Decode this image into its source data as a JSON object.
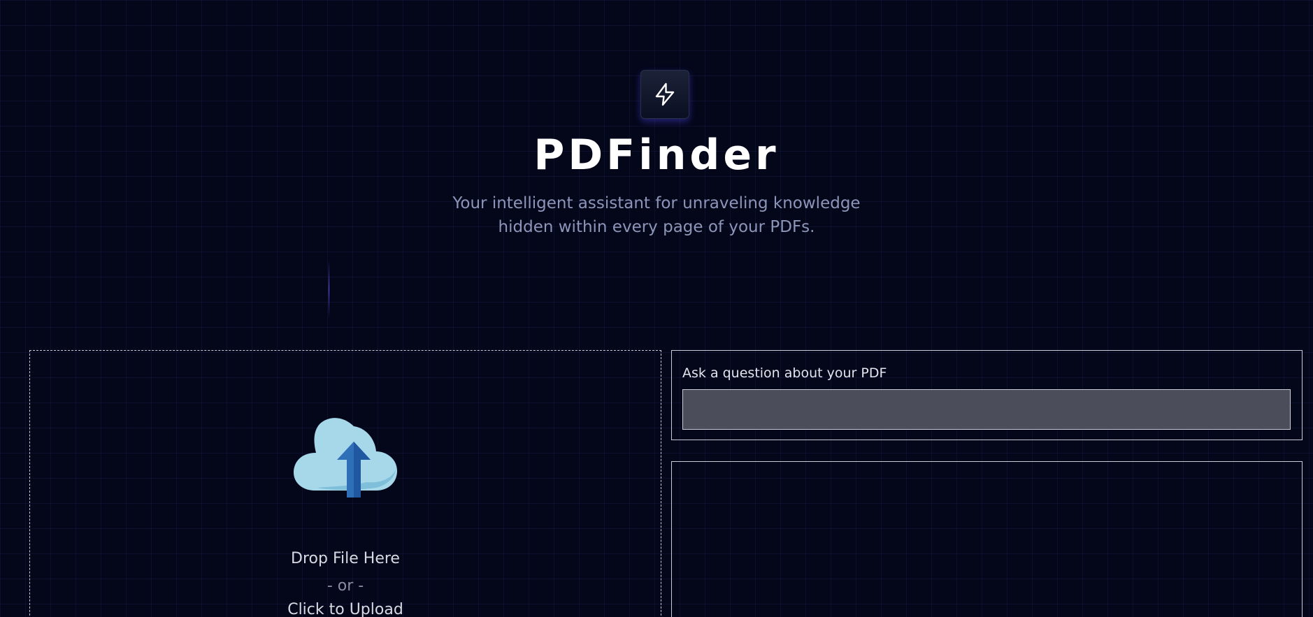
{
  "header": {
    "logo_icon": "lightning-bolt-icon",
    "title": "PDFinder",
    "tagline": "Your intelligent assistant for unraveling knowledge hidden within every page of your PDFs."
  },
  "upload": {
    "icon": "cloud-upload-icon",
    "drop_label": "Drop File Here",
    "or_label": "- or -",
    "click_label": "Click to Upload"
  },
  "question": {
    "label": "Ask a question about your PDF",
    "value": "",
    "placeholder": ""
  },
  "answer": {
    "text": ""
  },
  "colors": {
    "background": "#04061a",
    "accent": "#6a5cff",
    "input_bg": "#4b4d5a",
    "border": "#c9cbd6"
  }
}
